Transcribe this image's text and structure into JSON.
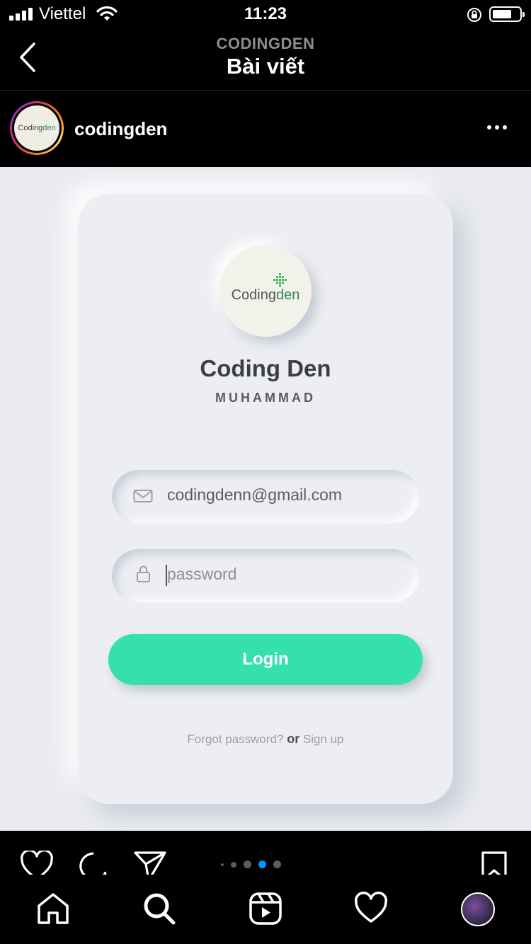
{
  "status_bar": {
    "carrier": "Viettel",
    "time": "11:23"
  },
  "header": {
    "subtitle": "CODINGDEN",
    "title": "Bài viết"
  },
  "post": {
    "username": "codingden",
    "avatar_logo": {
      "part1": "Coding",
      "part2": "den"
    },
    "image": {
      "logo": {
        "part1": "Coding",
        "part2": "den"
      },
      "brand_name": "Coding Den",
      "brand_sub": "MUHAMMAD",
      "email_value": "codingdenn@gmail.com",
      "password_placeholder": "password",
      "login_label": "Login",
      "forgot_label": "Forgot password?",
      "or_label": "or",
      "signup_label": "Sign up"
    },
    "carousel": {
      "total": 4,
      "active_index": 2
    }
  },
  "colors": {
    "accent_green": "#36e0ad",
    "card_bg": "#eceef2",
    "carousel_active": "#0095f6"
  },
  "icons": [
    "back-chevron-icon",
    "more-dots-icon",
    "heart-icon",
    "comment-icon",
    "share-icon",
    "bookmark-icon",
    "home-icon",
    "search-icon",
    "reels-icon",
    "activity-heart-icon",
    "profile-avatar",
    "mail-icon",
    "lock-icon"
  ]
}
